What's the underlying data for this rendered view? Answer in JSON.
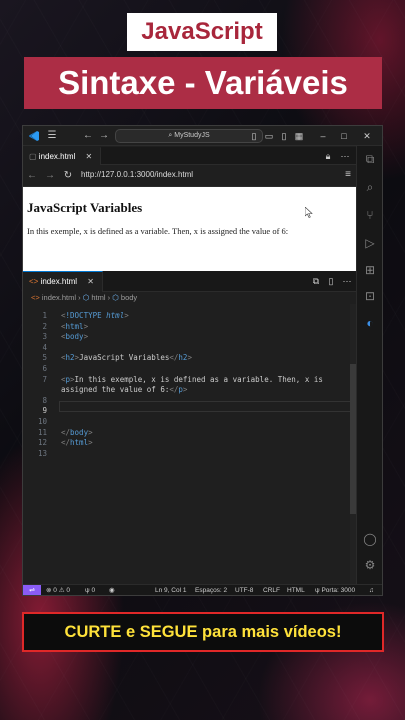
{
  "overlay": {
    "badge": "JavaScript",
    "title": "Sintaxe - Variáveis",
    "cta": "CURTE e SEGUE para mais vídeos!"
  },
  "titlebar": {
    "search": "MyStudyJS"
  },
  "browser": {
    "tab": "index.html",
    "url": "http://127.0.0.1:3000/index.html",
    "heading": "JavaScript Variables",
    "paragraph": "In this exemple, x is defined as a variable. Then, x is assigned the value of 6:"
  },
  "editor": {
    "tab": "index.html",
    "breadcrumb": [
      "index.html",
      "html",
      "body"
    ],
    "active_line": 9,
    "line_numbers": [
      "1",
      "2",
      "3",
      "4",
      "5",
      "6",
      "7",
      "",
      "8",
      "9",
      "10",
      "11",
      "12",
      "13"
    ],
    "lines": [
      "<!DOCTYPE html>",
      "<html>",
      "<body>",
      "",
      "<h2>JavaScript Variables</h2>",
      "",
      "<p>In this exemple, x is defined as a variable. Then, x is",
      "assigned the value of 6:</p>",
      "",
      "",
      "",
      "</body>",
      "</html>",
      ""
    ]
  },
  "statusbar": {
    "errors": "0",
    "warnings": "0",
    "ports": "0",
    "position": "Ln 9, Col 1",
    "spaces": "Espaços: 2",
    "encoding": "UTF-8",
    "eol": "CRLF",
    "language": "HTML",
    "port": "Porta: 3000"
  },
  "colors": {
    "badge_title_bg": "#ac2d45",
    "badge_js_text": "#a8263b",
    "cta_text": "#ffe23a",
    "cta_border": "#e02828",
    "accent": "#0078d4"
  }
}
